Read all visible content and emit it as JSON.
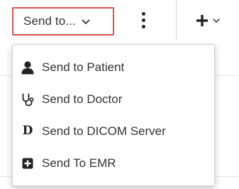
{
  "toolbar": {
    "send_label": "Send to...",
    "send_icon": "chevron-down-icon",
    "more_icon": "vertical-ellipsis-icon",
    "add_icon": "plus-icon",
    "add_chevron": "chevron-down-icon"
  },
  "send_menu": {
    "items": [
      {
        "label": "Send to Patient",
        "icon": "user-icon"
      },
      {
        "label": "Send to Doctor",
        "icon": "stethoscope-icon"
      },
      {
        "label": "Send to DICOM Server",
        "icon": "dicom-d-icon",
        "icon_text": "D"
      },
      {
        "label": "Send To EMR",
        "icon": "plus-square-icon"
      }
    ]
  },
  "colors": {
    "accent_border": "#d9534f",
    "text": "#333333",
    "icon": "#222222"
  }
}
